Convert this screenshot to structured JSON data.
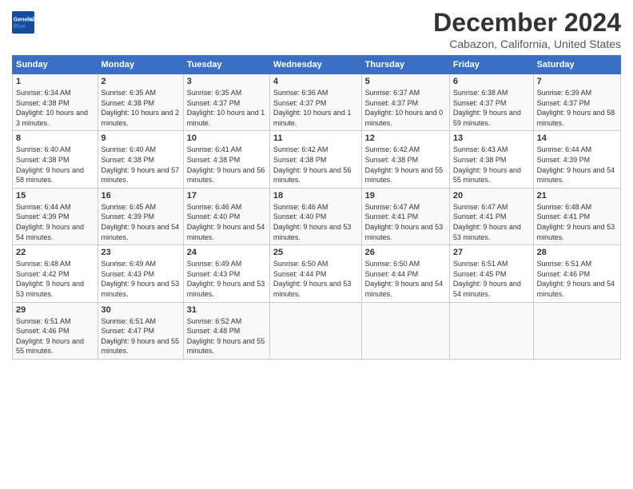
{
  "logo": {
    "line1": "General",
    "line2": "Blue"
  },
  "title": "December 2024",
  "subtitle": "Cabazon, California, United States",
  "days_of_week": [
    "Sunday",
    "Monday",
    "Tuesday",
    "Wednesday",
    "Thursday",
    "Friday",
    "Saturday"
  ],
  "weeks": [
    [
      {
        "day": "1",
        "sunrise": "6:34 AM",
        "sunset": "4:38 PM",
        "daylight": "10 hours and 3 minutes."
      },
      {
        "day": "2",
        "sunrise": "6:35 AM",
        "sunset": "4:38 PM",
        "daylight": "10 hours and 2 minutes."
      },
      {
        "day": "3",
        "sunrise": "6:35 AM",
        "sunset": "4:37 PM",
        "daylight": "10 hours and 1 minute."
      },
      {
        "day": "4",
        "sunrise": "6:36 AM",
        "sunset": "4:37 PM",
        "daylight": "10 hours and 1 minute."
      },
      {
        "day": "5",
        "sunrise": "6:37 AM",
        "sunset": "4:37 PM",
        "daylight": "10 hours and 0 minutes."
      },
      {
        "day": "6",
        "sunrise": "6:38 AM",
        "sunset": "4:37 PM",
        "daylight": "9 hours and 59 minutes."
      },
      {
        "day": "7",
        "sunrise": "6:39 AM",
        "sunset": "4:37 PM",
        "daylight": "9 hours and 58 minutes."
      }
    ],
    [
      {
        "day": "8",
        "sunrise": "6:40 AM",
        "sunset": "4:38 PM",
        "daylight": "9 hours and 58 minutes."
      },
      {
        "day": "9",
        "sunrise": "6:40 AM",
        "sunset": "4:38 PM",
        "daylight": "9 hours and 57 minutes."
      },
      {
        "day": "10",
        "sunrise": "6:41 AM",
        "sunset": "4:38 PM",
        "daylight": "9 hours and 56 minutes."
      },
      {
        "day": "11",
        "sunrise": "6:42 AM",
        "sunset": "4:38 PM",
        "daylight": "9 hours and 56 minutes."
      },
      {
        "day": "12",
        "sunrise": "6:42 AM",
        "sunset": "4:38 PM",
        "daylight": "9 hours and 55 minutes."
      },
      {
        "day": "13",
        "sunrise": "6:43 AM",
        "sunset": "4:38 PM",
        "daylight": "9 hours and 55 minutes."
      },
      {
        "day": "14",
        "sunrise": "6:44 AM",
        "sunset": "4:39 PM",
        "daylight": "9 hours and 54 minutes."
      }
    ],
    [
      {
        "day": "15",
        "sunrise": "6:44 AM",
        "sunset": "4:39 PM",
        "daylight": "9 hours and 54 minutes."
      },
      {
        "day": "16",
        "sunrise": "6:45 AM",
        "sunset": "4:39 PM",
        "daylight": "9 hours and 54 minutes."
      },
      {
        "day": "17",
        "sunrise": "6:46 AM",
        "sunset": "4:40 PM",
        "daylight": "9 hours and 54 minutes."
      },
      {
        "day": "18",
        "sunrise": "6:46 AM",
        "sunset": "4:40 PM",
        "daylight": "9 hours and 53 minutes."
      },
      {
        "day": "19",
        "sunrise": "6:47 AM",
        "sunset": "4:41 PM",
        "daylight": "9 hours and 53 minutes."
      },
      {
        "day": "20",
        "sunrise": "6:47 AM",
        "sunset": "4:41 PM",
        "daylight": "9 hours and 53 minutes."
      },
      {
        "day": "21",
        "sunrise": "6:48 AM",
        "sunset": "4:41 PM",
        "daylight": "9 hours and 53 minutes."
      }
    ],
    [
      {
        "day": "22",
        "sunrise": "6:48 AM",
        "sunset": "4:42 PM",
        "daylight": "9 hours and 53 minutes."
      },
      {
        "day": "23",
        "sunrise": "6:49 AM",
        "sunset": "4:43 PM",
        "daylight": "9 hours and 53 minutes."
      },
      {
        "day": "24",
        "sunrise": "6:49 AM",
        "sunset": "4:43 PM",
        "daylight": "9 hours and 53 minutes."
      },
      {
        "day": "25",
        "sunrise": "6:50 AM",
        "sunset": "4:44 PM",
        "daylight": "9 hours and 53 minutes."
      },
      {
        "day": "26",
        "sunrise": "6:50 AM",
        "sunset": "4:44 PM",
        "daylight": "9 hours and 54 minutes."
      },
      {
        "day": "27",
        "sunrise": "6:51 AM",
        "sunset": "4:45 PM",
        "daylight": "9 hours and 54 minutes."
      },
      {
        "day": "28",
        "sunrise": "6:51 AM",
        "sunset": "4:46 PM",
        "daylight": "9 hours and 54 minutes."
      }
    ],
    [
      {
        "day": "29",
        "sunrise": "6:51 AM",
        "sunset": "4:46 PM",
        "daylight": "9 hours and 55 minutes."
      },
      {
        "day": "30",
        "sunrise": "6:51 AM",
        "sunset": "4:47 PM",
        "daylight": "9 hours and 55 minutes."
      },
      {
        "day": "31",
        "sunrise": "6:52 AM",
        "sunset": "4:48 PM",
        "daylight": "9 hours and 55 minutes."
      },
      null,
      null,
      null,
      null
    ]
  ]
}
